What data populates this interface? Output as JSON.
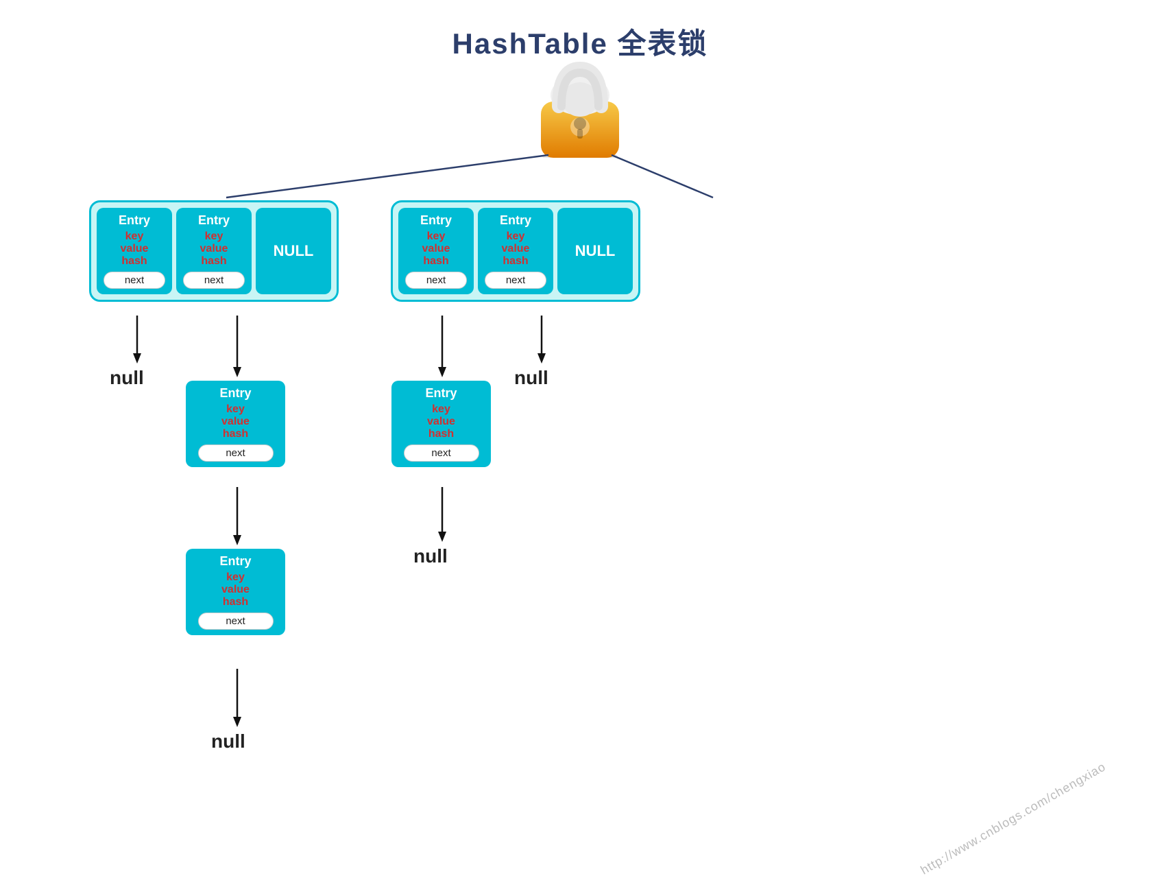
{
  "title": "HashTable 全表锁",
  "lock": {
    "alt": "lock icon"
  },
  "hashtable": {
    "left_group": [
      {
        "type": "entry",
        "label": "Entry",
        "key": "key",
        "value": "value",
        "hash": "hash",
        "next": "next"
      },
      {
        "type": "entry",
        "label": "Entry",
        "key": "key",
        "value": "value",
        "hash": "hash",
        "next": "next"
      },
      {
        "type": "null",
        "label": "NULL"
      }
    ],
    "right_group": [
      {
        "type": "entry",
        "label": "Entry",
        "key": "key",
        "value": "value",
        "hash": "hash",
        "next": "next"
      },
      {
        "type": "entry",
        "label": "Entry",
        "key": "key",
        "value": "value",
        "hash": "hash",
        "next": "next"
      },
      {
        "type": "null",
        "label": "NULL"
      }
    ]
  },
  "chain1": {
    "entry1": {
      "label": "Entry",
      "key": "key",
      "value": "value",
      "hash": "hash",
      "next": "next"
    },
    "entry2": {
      "label": "Entry",
      "key": "key",
      "value": "value",
      "hash": "hash",
      "next": "next"
    },
    "null": "null"
  },
  "chain2": {
    "entry1": {
      "label": "Entry",
      "key": "key",
      "value": "value",
      "hash": "hash",
      "next": "next"
    },
    "null": "null"
  },
  "null_labels": {
    "left": "null",
    "right": "null",
    "chain1_bottom": "null",
    "chain2_bottom": "null"
  },
  "watermark": "http://www.cnblogs.com/chengxiao"
}
